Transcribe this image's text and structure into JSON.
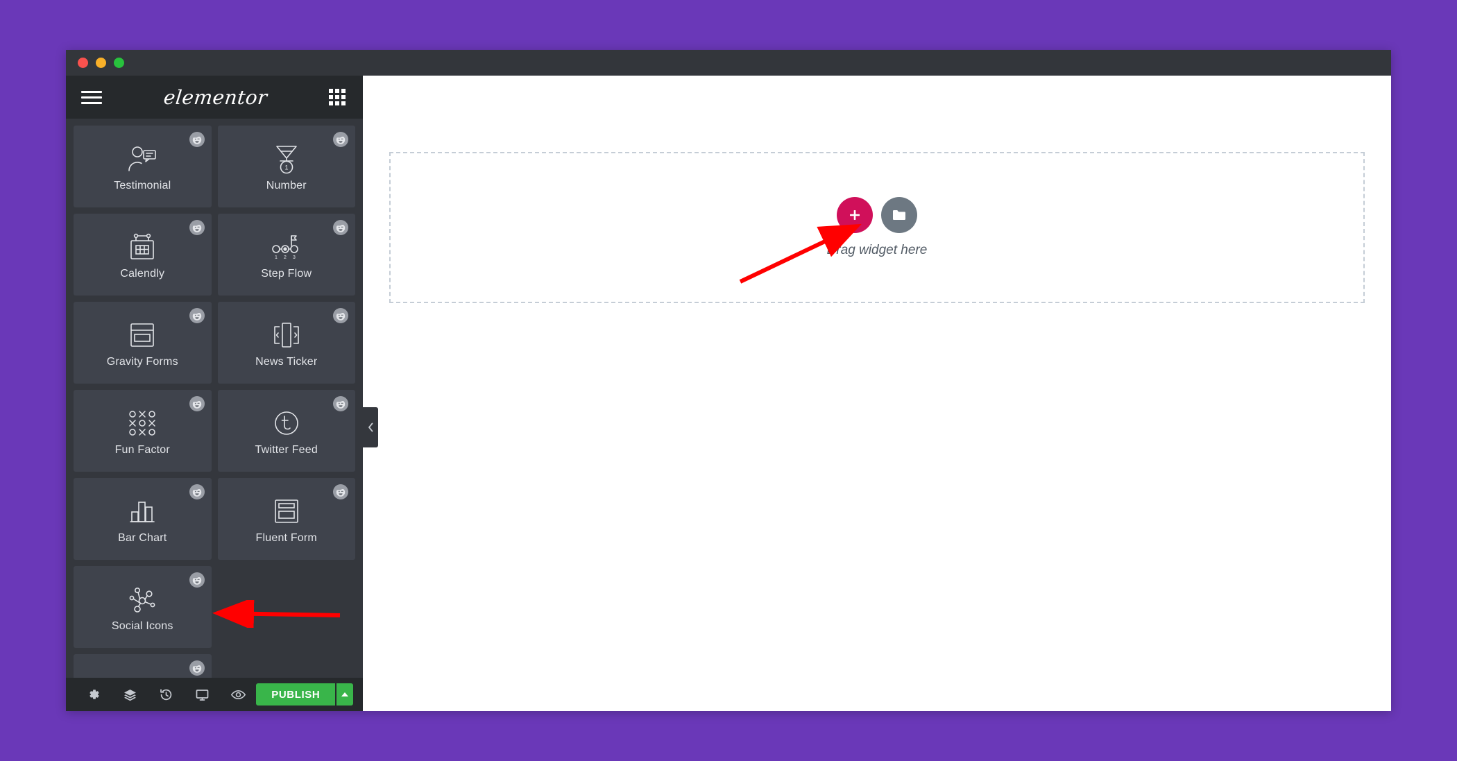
{
  "window": {
    "traffic_lights": [
      "close",
      "minimize",
      "maximize"
    ],
    "colors": {
      "backdrop_purple": "#6A38B8",
      "titlebar": "#33363B",
      "panel_bg": "#34373D",
      "panel_header": "#26292C",
      "card_bg": "#3F434C",
      "accent_pink": "#D0105A",
      "publish_green": "#39B54A",
      "arrow_red": "#FF0000",
      "dashed_border": "#C5CDD6"
    }
  },
  "panel": {
    "header": {
      "menu_icon": "hamburger-icon",
      "brand": "elementor",
      "grid_icon": "widgets-grid-icon"
    },
    "widgets": [
      {
        "label": "Testimonial",
        "icon": "testimonial-icon"
      },
      {
        "label": "Number",
        "icon": "medal-number-icon"
      },
      {
        "label": "Calendly",
        "icon": "calendar-icon"
      },
      {
        "label": "Step Flow",
        "icon": "step-flow-icon"
      },
      {
        "label": "Gravity Forms",
        "icon": "form-layout-icon"
      },
      {
        "label": "News Ticker",
        "icon": "news-ticker-icon"
      },
      {
        "label": "Fun Factor",
        "icon": "tic-tac-toe-icon"
      },
      {
        "label": "Twitter Feed",
        "icon": "twitter-circle-icon"
      },
      {
        "label": "Bar Chart",
        "icon": "bar-chart-icon"
      },
      {
        "label": "Fluent Form",
        "icon": "form-layout-icon"
      },
      {
        "label": "Social Icons",
        "icon": "network-nodes-icon"
      }
    ],
    "badge_icon": "happy-face-badge-icon",
    "footer": {
      "tools": [
        {
          "name": "settings",
          "icon": "gear-icon"
        },
        {
          "name": "navigator",
          "icon": "layers-icon"
        },
        {
          "name": "history",
          "icon": "history-clock-icon"
        },
        {
          "name": "responsive",
          "icon": "monitor-icon"
        },
        {
          "name": "preview",
          "icon": "eye-icon"
        }
      ],
      "publish_label": "PUBLISH",
      "publish_caret_icon": "caret-up-icon"
    },
    "collapse_icon": "chevron-left-icon"
  },
  "canvas": {
    "dropzone": {
      "add_icon": "plus-icon",
      "folder_icon": "folder-icon",
      "text": "Drag widget here"
    }
  },
  "annotations": [
    {
      "name": "arrow-to-drag-widget-here",
      "color": "#FF0000"
    },
    {
      "name": "arrow-to-social-icons",
      "color": "#FF0000"
    }
  ]
}
